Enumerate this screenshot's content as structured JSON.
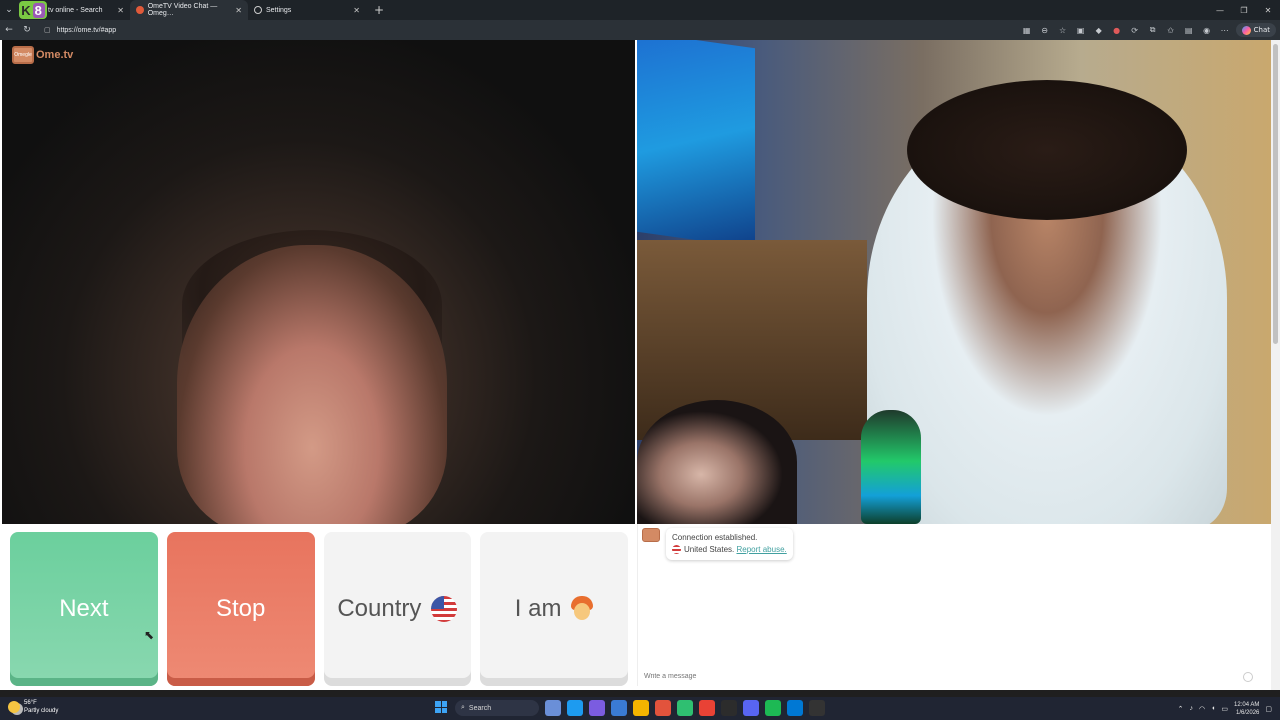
{
  "browser": {
    "tabs": [
      {
        "title": "tv online - Search",
        "active": false
      },
      {
        "title": "OmeTV Video Chat — Omeg…",
        "active": true
      },
      {
        "title": "Settings",
        "active": false
      }
    ],
    "new_tab": "+",
    "url": "https://ome.tv/#app",
    "chat_button": "Chat",
    "k8_badge": {
      "k": "K",
      "eight": "8"
    }
  },
  "logo": {
    "icon_text": "Omegle",
    "text": "Ome.tv"
  },
  "controls": {
    "next": "Next",
    "stop": "Stop",
    "country": "Country",
    "iam": "I am"
  },
  "chat": {
    "status": "Connection established.",
    "location": "United States.",
    "report": "Report abuse.",
    "placeholder": "Write a message"
  },
  "taskbar": {
    "weather_temp": "56°F",
    "weather_desc": "Partly cloudy",
    "search": "Search",
    "time": "12:04 AM",
    "date": "1/6/2026"
  },
  "colors": {
    "next": "#6bcf9d",
    "stop": "#e8745e",
    "accent": "#d38a64"
  },
  "icons": [
    "back-icon",
    "refresh-icon",
    "lock-icon",
    "star-icon",
    "gear-icon",
    "windows-start-icon",
    "search-icon",
    "flag-us-icon",
    "avatar-emoji-icon"
  ]
}
